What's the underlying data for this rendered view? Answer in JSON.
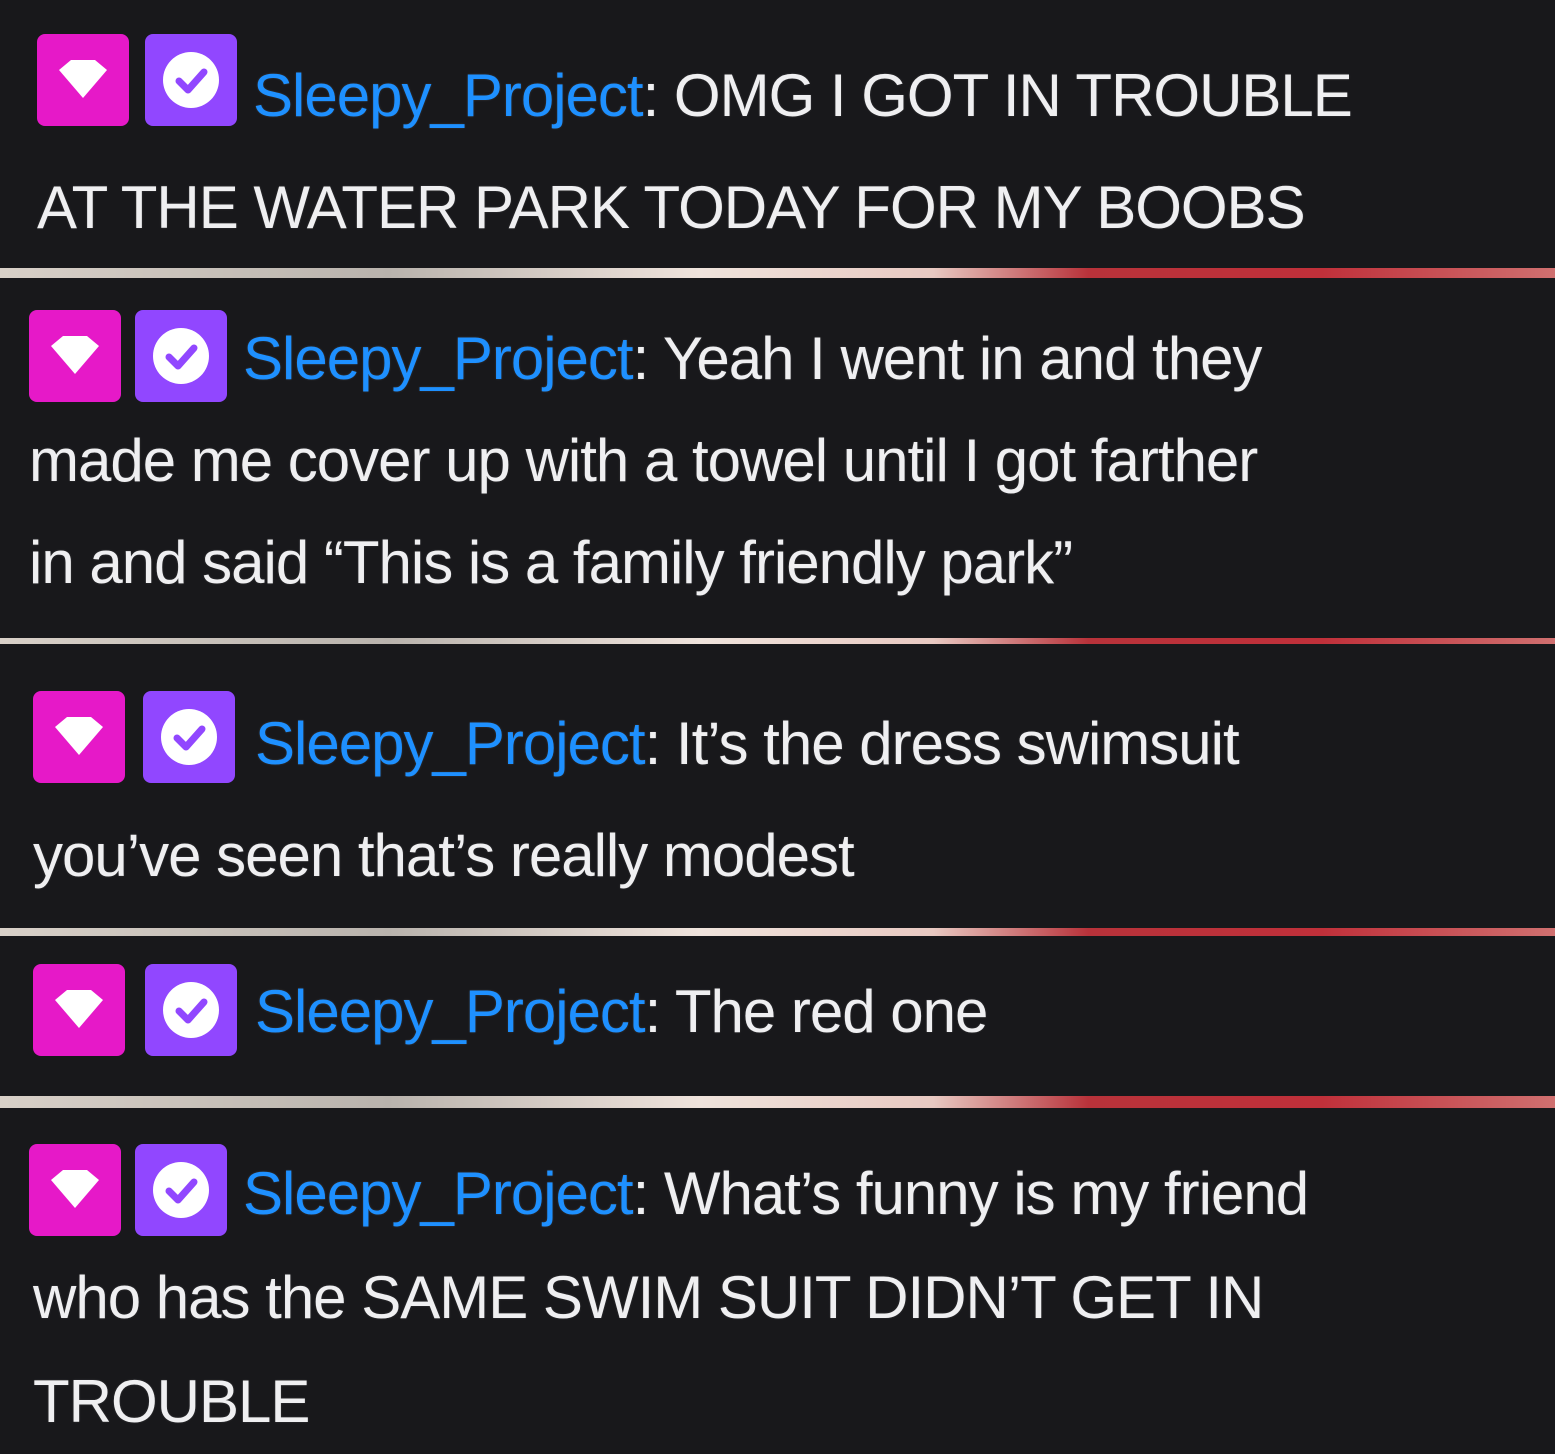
{
  "colors": {
    "background": "#18181b",
    "username": "#1e90ff",
    "message_text": "#efeff1",
    "gem_badge": "#e619c8",
    "verified_badge": "#9147ff"
  },
  "badges": {
    "gem": "gem-icon",
    "verified": "verified-check-icon"
  },
  "messages": [
    {
      "username": "Sleepy_Project",
      "separator": ":",
      "lines": [
        "OMG I GOT IN TROUBLE",
        "AT THE WATER PARK TODAY FOR MY BOOBS"
      ]
    },
    {
      "username": "Sleepy_Project",
      "separator": ":",
      "lines": [
        "Yeah I went in and they",
        "made me cover up with a towel until I got farther",
        "in and said “This is a family friendly park”"
      ]
    },
    {
      "username": "Sleepy_Project",
      "separator": ":",
      "lines": [
        "It’s the dress swimsuit",
        "you’ve seen that’s really modest"
      ]
    },
    {
      "username": "Sleepy_Project",
      "separator": ":",
      "lines": [
        "The red one"
      ]
    },
    {
      "username": "Sleepy_Project",
      "separator": ":",
      "lines": [
        "What’s funny is my friend",
        "who has the SAME SWIM SUIT DIDN’T GET IN",
        "TROUBLE"
      ]
    }
  ]
}
